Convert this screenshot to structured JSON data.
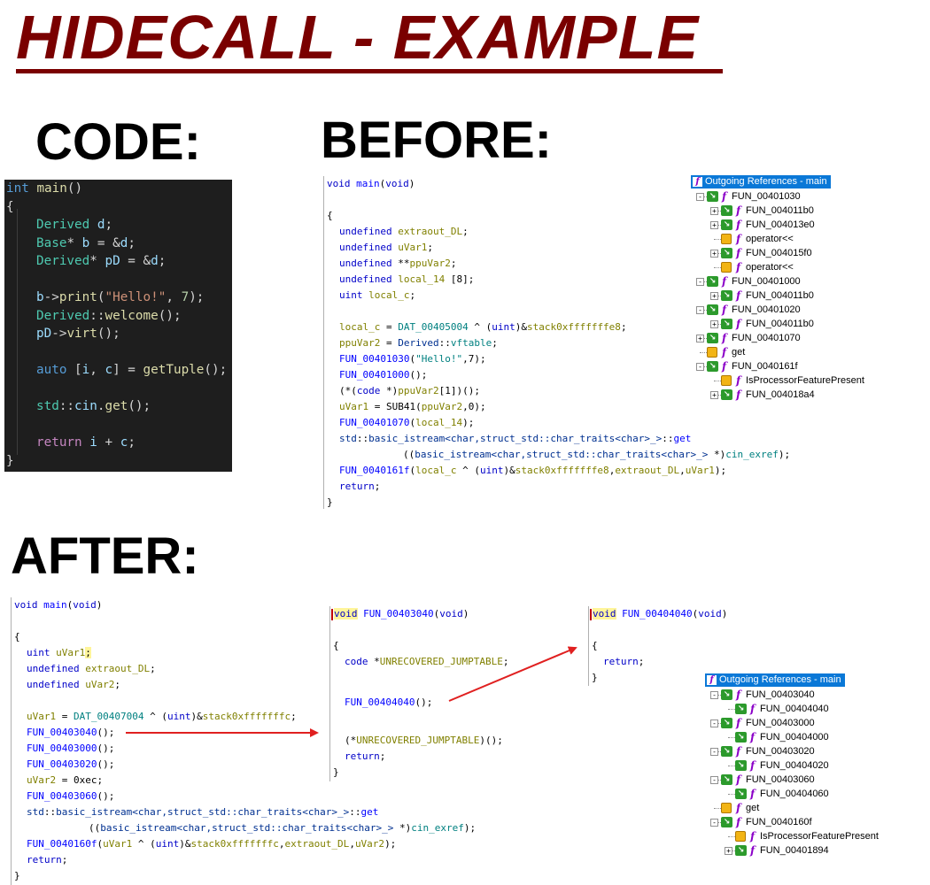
{
  "header": {
    "title": "HIDECALL - EXAMPLE",
    "code_label": "CODE:",
    "before_label": "BEFORE:",
    "after_label": "AFTER:"
  },
  "source_code": [
    "int main()",
    "{",
    "Derived d;",
    "Base* b = &d;",
    "Derived* pD = &d;",
    "b->print(\"Hello!\", 7);",
    "Derived::welcome();",
    "pD->virt();",
    "auto [i, c] = getTuple();",
    "std::cin.get();",
    "return i + c;",
    "}"
  ],
  "before": {
    "decompile": [
      "void main(void)",
      "{",
      "undefined extraout_DL;",
      "undefined uVar1;",
      "undefined **ppuVar2;",
      "undefined local_14 [8];",
      "uint local_c;",
      "local_c = DAT_00405004 ^ (uint)&stack0xfffffffe8;",
      "ppuVar2 = Derived::vftable;",
      "FUN_00401030(\"Hello!\",7);",
      "FUN_00401000();",
      "(*(code *)ppuVar2[1])();",
      "uVar1 = SUB41(ppuVar2,0);",
      "FUN_00401070(local_14);",
      "std::basic_istream<char,struct_std::char_traits<char>_>::get",
      "((basic_istream<char,struct_std::char_traits<char>_> *)cin_exref);",
      "FUN_0040161f(local_c ^ (uint)&stack0xfffffffe8,extraout_DL,uVar1);",
      "return;",
      "}"
    ],
    "refs_title": "Outgoing References - main",
    "refs": [
      "FUN_00401030",
      "FUN_004011b0",
      "FUN_004013e0",
      "operator<<",
      "FUN_004015f0",
      "operator<<",
      "FUN_00401000",
      "FUN_004011b0",
      "FUN_00401020",
      "FUN_004011b0",
      "FUN_00401070",
      "get",
      "FUN_0040161f",
      "IsProcessorFeaturePresent",
      "FUN_004018a4"
    ]
  },
  "after": {
    "main_decompile": [
      "void main(void)",
      "{",
      "uint uVar1;",
      "undefined extraout_DL;",
      "undefined uVar2;",
      "uVar1 = DAT_00407004 ^ (uint)&stack0xfffffffc;",
      "FUN_00403040();",
      "FUN_00403000();",
      "FUN_00403020();",
      "uVar2 = 0xec;",
      "FUN_00403060();",
      "std::basic_istream<char,struct_std::char_traits<char>_>::get",
      "((basic_istream<char,struct_std::char_traits<char>_> *)cin_exref);",
      "FUN_0040160f(uVar1 ^ (uint)&stack0xfffffffc,extraout_DL,uVar2);",
      "return;",
      "}"
    ],
    "fn1_decompile": [
      "void FUN_00403040(void)",
      "{",
      "code *UNRECOVERED_JUMPTABLE;",
      "FUN_00404040();",
      "(*UNRECOVERED_JUMPTABLE)();",
      "return;",
      "}"
    ],
    "fn2_decompile": [
      "void FUN_00404040(void)",
      "{",
      "return;",
      "}"
    ],
    "refs_title": "Outgoing References - main",
    "refs": [
      "FUN_00403040",
      "FUN_00404040",
      "FUN_00403000",
      "FUN_00404000",
      "FUN_00403020",
      "FUN_00404020",
      "FUN_00403060",
      "FUN_00404060",
      "get",
      "FUN_0040160f",
      "IsProcessorFeaturePresent",
      "FUN_00401894"
    ]
  },
  "colors": {
    "title": "#7a0000",
    "code_bg": "#1e1e1e",
    "refs_header": "#0a78d7",
    "arrow": "#e02020"
  }
}
